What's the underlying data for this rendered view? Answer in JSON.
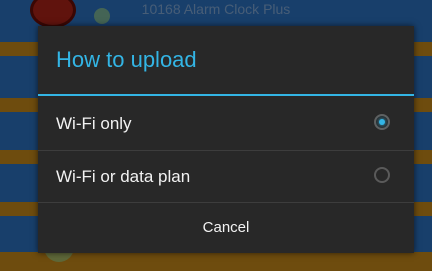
{
  "background": {
    "title": "10168 Alarm Clock Plus"
  },
  "dialog": {
    "title": "How to upload",
    "options": [
      {
        "label": "Wi-Fi only",
        "selected": true
      },
      {
        "label": "Wi-Fi or data plan",
        "selected": false
      }
    ],
    "cancel_label": "Cancel"
  },
  "colors": {
    "accent": "#33b5e5",
    "dialog_bg": "#282828"
  }
}
